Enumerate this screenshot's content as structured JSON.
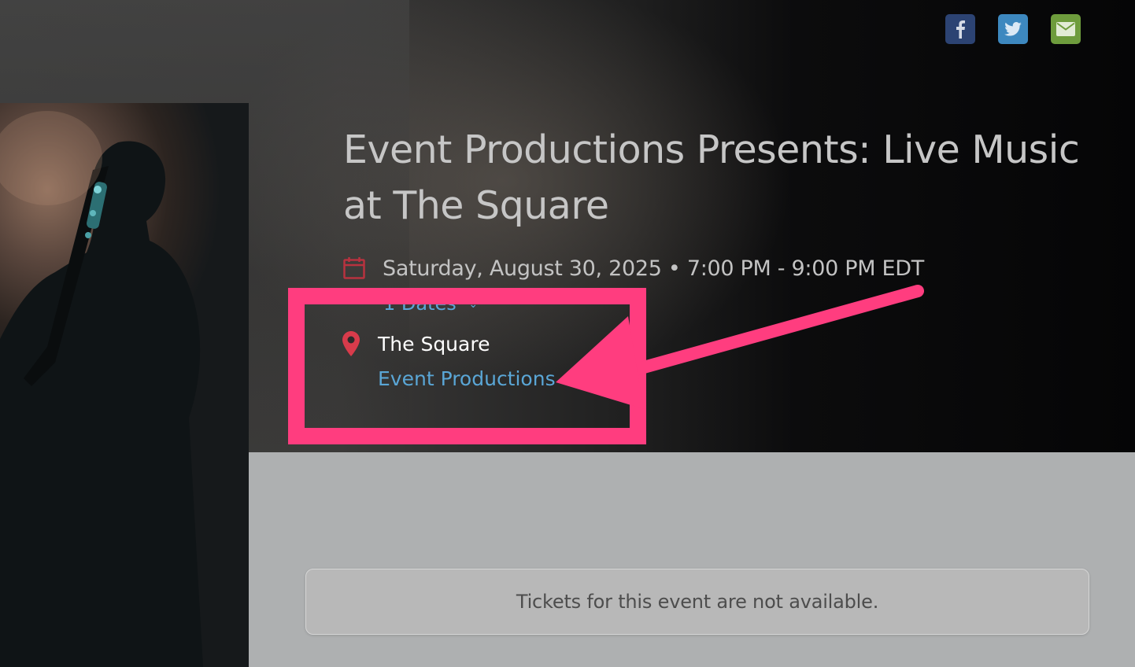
{
  "share": {
    "facebook_icon": "facebook-icon",
    "twitter_icon": "twitter-icon",
    "email_icon": "email-icon",
    "colors": {
      "facebook": "#2c4373",
      "twitter": "#3d88bf",
      "email": "#6e9c3d"
    }
  },
  "event": {
    "title": "Event Productions Presents: Live Music at The Square",
    "date_time": "Saturday, August 30, 2025 • 7:00 PM - 9:00 PM EDT",
    "dates_link": "1 Dates",
    "venue": "The Square",
    "organizer": "Event Productions"
  },
  "tickets": {
    "message": "Tickets for this event are not available."
  },
  "colors": {
    "accent_red": "#d83b4b",
    "link_blue": "#5aa6d6",
    "annotation_pink": "#ff3d7f"
  }
}
